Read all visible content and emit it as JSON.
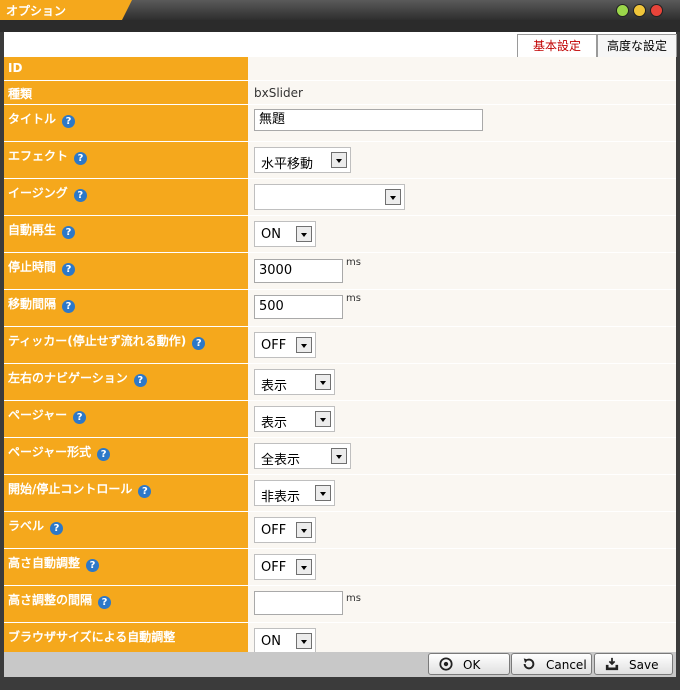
{
  "window": {
    "title": "オプション"
  },
  "tabs": [
    {
      "label": "基本設定",
      "active": true
    },
    {
      "label": "高度な設定",
      "active": false
    }
  ],
  "rows": [
    {
      "label": "ID",
      "value": ""
    },
    {
      "label": "種類",
      "value": "bxSlider"
    },
    {
      "label": "タイトル",
      "value": "無題"
    },
    {
      "label": "エフェクト",
      "value": "水平移動"
    },
    {
      "label": "イージング",
      "value": ""
    },
    {
      "label": "自動再生",
      "value": "ON"
    },
    {
      "label": "停止時間",
      "value": "3000",
      "unit": "ms"
    },
    {
      "label": "移動間隔",
      "value": "500",
      "unit": "ms"
    },
    {
      "label": "ティッカー(停止せず流れる動作)",
      "value": "OFF"
    },
    {
      "label": "左右のナビゲーション",
      "value": "表示"
    },
    {
      "label": "ページャー",
      "value": "表示"
    },
    {
      "label": "ページャー形式",
      "value": "全表示"
    },
    {
      "label": "開始/停止コントロール",
      "value": "非表示"
    },
    {
      "label": "ラベル",
      "value": "OFF"
    },
    {
      "label": "高さ自動調整",
      "value": "OFF"
    },
    {
      "label": "高さ調整の間隔",
      "value": "",
      "unit": "ms"
    },
    {
      "label": "ブラウザサイズによる自動調整",
      "value": "ON"
    }
  ],
  "help_glyph": "?",
  "buttons": {
    "ok": "OK",
    "cancel": "Cancel",
    "save": "Save"
  },
  "colors": {
    "accent": "#f5a81c",
    "help": "#2c78c8",
    "active_tab_text": "#c00000"
  }
}
